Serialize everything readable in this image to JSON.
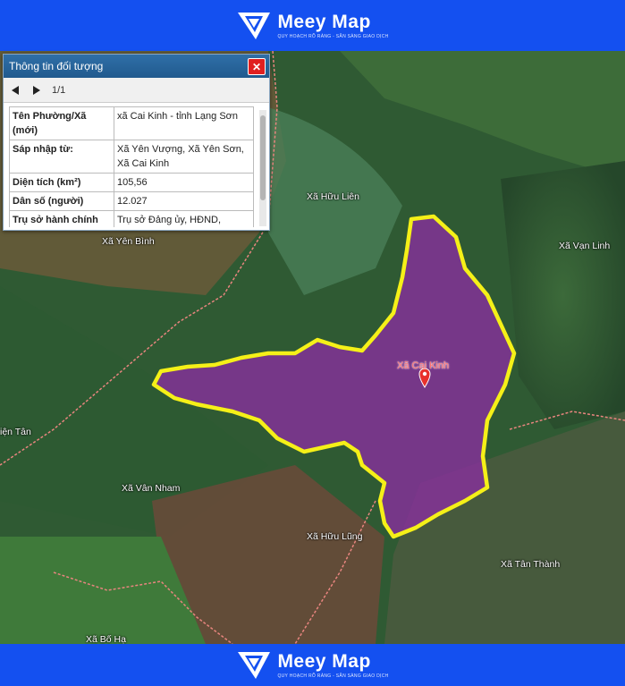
{
  "brand": {
    "name": "Meey Map",
    "tagline": "QUY HOẠCH RÕ RÀNG - SẴN SÀNG GIAO DỊCH"
  },
  "panel": {
    "title": "Thông tin đối tượng",
    "close_label": "✕",
    "page_indicator": "1/1",
    "rows": [
      {
        "key": "Tên Phường/Xã (mới)",
        "value": "xã Cai Kinh - tỉnh Lạng Sơn"
      },
      {
        "key": "Sáp nhập từ:",
        "value": "Xã Yên Vượng, Xã Yên Sơn, Xã Cai Kinh"
      },
      {
        "key": "Diện tích (km²)",
        "value": "105,56"
      },
      {
        "key": "Dân số (người)",
        "value": "12.027"
      },
      {
        "key": "Trụ sở hành chính (mới)",
        "value": "Trụ sở Đảng ủy, HĐND, UBND xã Cai Kinh"
      }
    ]
  },
  "map": {
    "highlight_color": "#8a2da0",
    "boundary_color": "#f5f018",
    "marker_color": "#e8312c",
    "places": {
      "huu_lien": "Xã Hữu Liên",
      "van_linh": "Xã Vạn Linh",
      "yen_binh": "Xã Yên Bình",
      "cai_kinh": "Xã Cai Kinh",
      "thien_tan": "iện Tân",
      "van_nham": "Xã Vân Nham",
      "huu_lung": "Xã Hữu Lũng",
      "tan_thanh": "Xã Tân Thành",
      "bo_ha": "Xã Bố Hạ"
    }
  }
}
